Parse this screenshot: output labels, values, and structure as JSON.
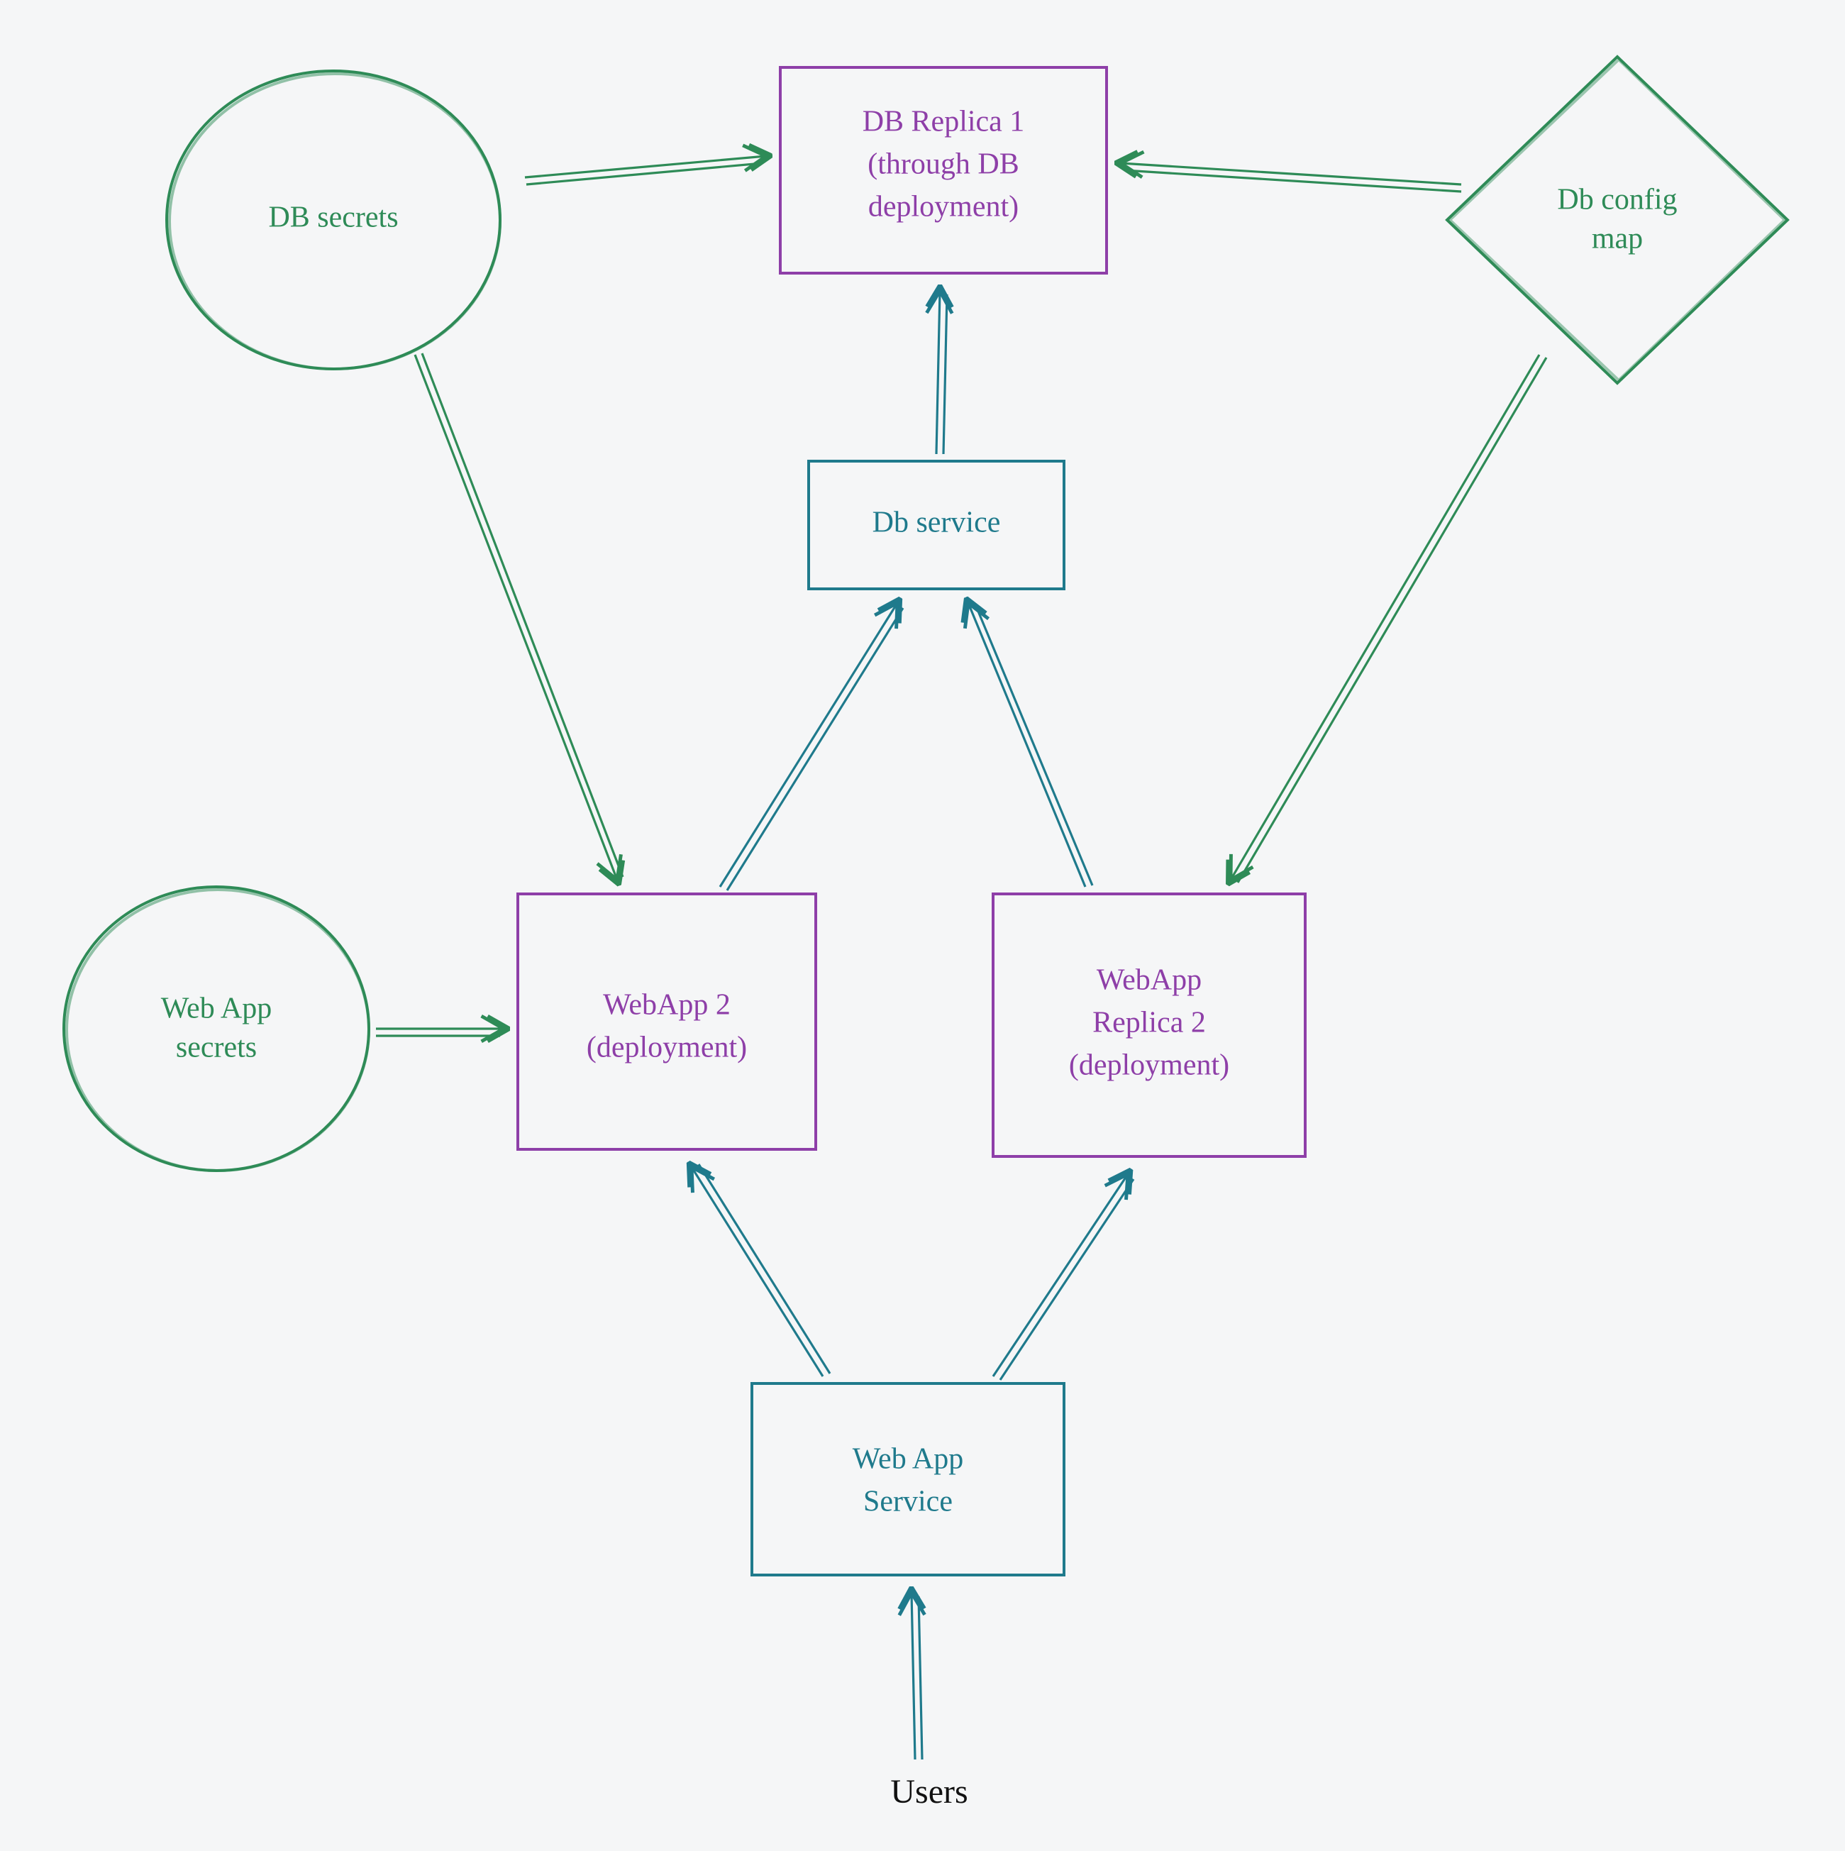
{
  "nodes": {
    "db_secrets": "DB secrets",
    "webapp_secrets_l1": "Web App",
    "webapp_secrets_l2": "secrets",
    "db_replica_l1": "DB Replica 1",
    "db_replica_l2": "(through DB",
    "db_replica_l3": "deployment)",
    "db_service": "Db service",
    "db_config_l1": "Db config",
    "db_config_l2": "map",
    "webapp2_l1": "WebApp 2",
    "webapp2_l2": "(deployment)",
    "webapp_r2_l1": "WebApp",
    "webapp_r2_l2": "Replica 2",
    "webapp_r2_l3": "(deployment)",
    "webapp_service_l1": "Web App",
    "webapp_service_l2": "Service",
    "users": "Users"
  }
}
